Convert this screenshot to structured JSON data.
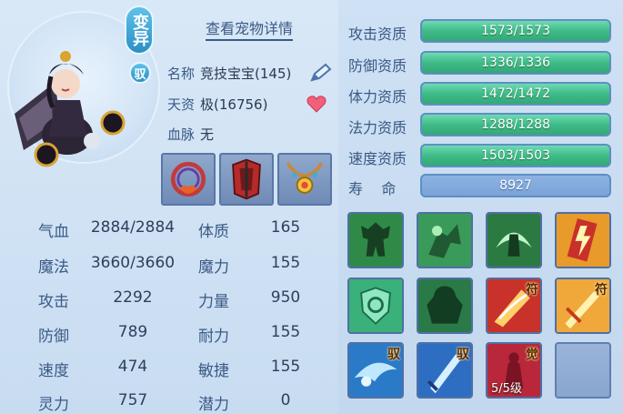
{
  "pet": {
    "mutate_badge": "变异",
    "tame_badge": "驭",
    "detail_link": "查看宠物详情",
    "name_label": "名称",
    "name_value": "竞技宝宝(145)",
    "aptitude_label": "天资",
    "aptitude_value": "极(16756)",
    "bloodline_label": "血脉",
    "bloodline_value": "无"
  },
  "equipment": [
    {
      "name": "collar"
    },
    {
      "name": "armor"
    },
    {
      "name": "necklace"
    }
  ],
  "stats": [
    {
      "label": "气血",
      "value": "2884/2884"
    },
    {
      "label": "魔法",
      "value": "3660/3660"
    },
    {
      "label": "攻击",
      "value": "2292"
    },
    {
      "label": "防御",
      "value": "789"
    },
    {
      "label": "速度",
      "value": "474"
    },
    {
      "label": "灵力",
      "value": "757"
    }
  ],
  "points": [
    {
      "label": "体质",
      "value": "165"
    },
    {
      "label": "魔力",
      "value": "155"
    },
    {
      "label": "力量",
      "value": "950"
    },
    {
      "label": "耐力",
      "value": "155"
    },
    {
      "label": "敏捷",
      "value": "155"
    },
    {
      "label": "潜力",
      "value": "0"
    }
  ],
  "qualities": [
    {
      "label": "攻击资质",
      "value": "1573/1573"
    },
    {
      "label": "防御资质",
      "value": "1336/1336"
    },
    {
      "label": "体力资质",
      "value": "1472/1472"
    },
    {
      "label": "法力资质",
      "value": "1288/1288"
    },
    {
      "label": "速度资质",
      "value": "1503/1503"
    }
  ],
  "life": {
    "label": "寿    命",
    "value": "8927"
  },
  "skills": [
    {
      "icon": "strength-icon",
      "tag": ""
    },
    {
      "icon": "shadow-strike-icon",
      "tag": ""
    },
    {
      "icon": "crescent-knight-icon",
      "tag": ""
    },
    {
      "icon": "lightning-charm-icon",
      "tag": ""
    },
    {
      "icon": "shield-heal-icon",
      "tag": ""
    },
    {
      "icon": "giant-icon",
      "tag": ""
    },
    {
      "icon": "fire-slash-icon",
      "tag": "符"
    },
    {
      "icon": "golden-blade-icon",
      "tag": "符"
    },
    {
      "icon": "water-dash-icon",
      "tag": "驭"
    },
    {
      "icon": "sword-icon",
      "tag": "驭"
    },
    {
      "icon": "awaken-icon",
      "tag": "觉",
      "level": "5/5级"
    }
  ],
  "colors": {
    "bar_green": "#3ebb87",
    "bar_border": "#5e8fc2",
    "label_blue": "#3a5a86"
  }
}
